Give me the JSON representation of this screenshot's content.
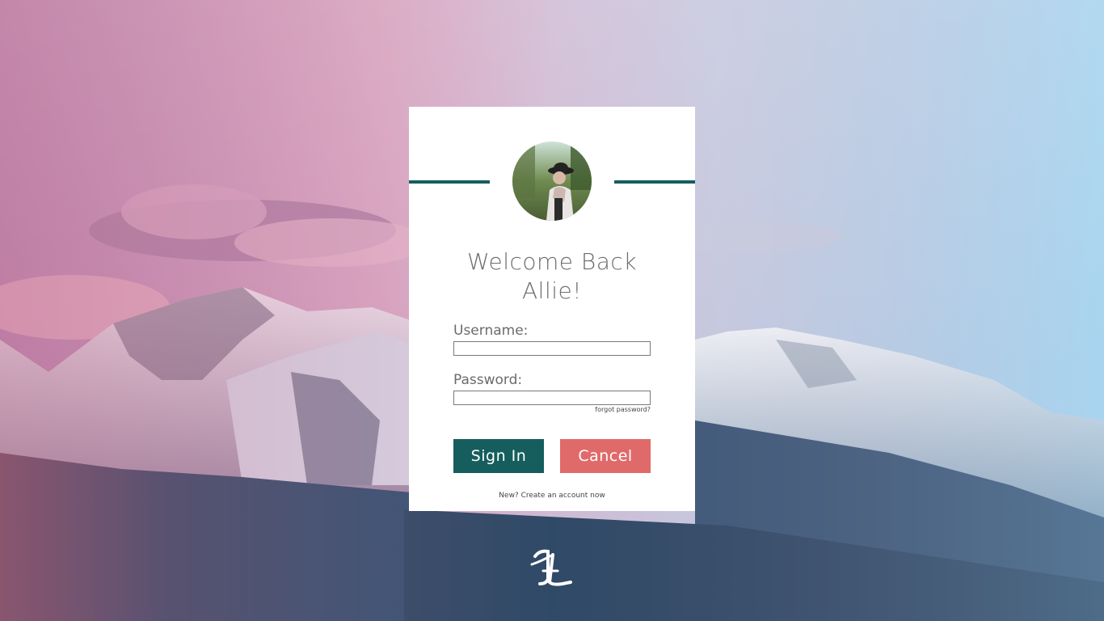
{
  "background": {
    "description_icon": "mountain-landscape",
    "sky_top_left": "#c990b8",
    "sky_top_right": "#a9d3ee",
    "mountain_base": "#2f4a66"
  },
  "login": {
    "welcome_line1": "Welcome Back",
    "welcome_line2": "Allie!",
    "username_label": "Username:",
    "username_value": "",
    "password_label": "Password:",
    "password_value": "",
    "forgot_password": "forgot password?",
    "signin_label": "Sign In",
    "cancel_label": "Cancel",
    "create_account": "New? Create an account now"
  },
  "colors": {
    "accent": "#155e5d",
    "cancel": "#e06a6a",
    "card": "#ffffff",
    "text": "#6d6d6d"
  },
  "icons": {
    "avatar": "profile-photo-icon",
    "logo": "al-monogram-logo-icon"
  }
}
